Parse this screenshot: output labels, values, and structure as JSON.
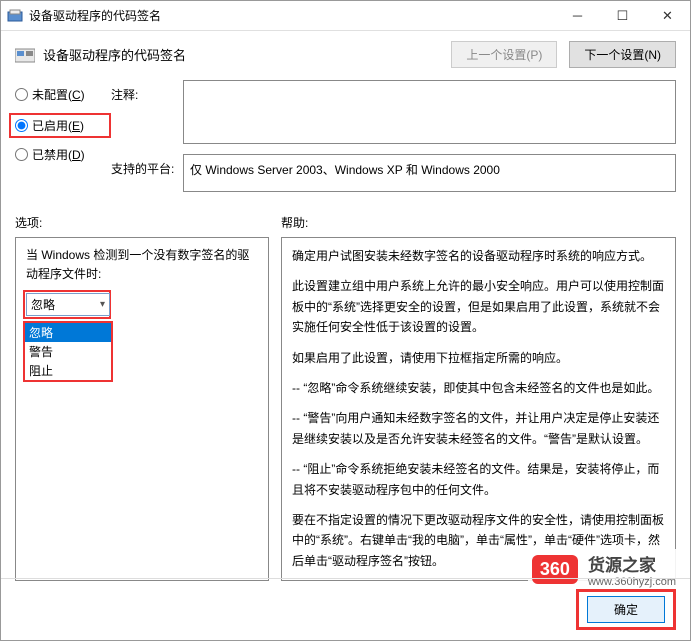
{
  "window": {
    "title": "设备驱动程序的代码签名"
  },
  "header": {
    "title": "设备驱动程序的代码签名",
    "prev_btn": "上一个设置(P)",
    "next_btn": "下一个设置(N)"
  },
  "radios": {
    "not_configured": "未配置(C)",
    "enabled": "已启用(E)",
    "disabled": "已禁用(D)"
  },
  "fields": {
    "comment_label": "注释:",
    "comment_value": "",
    "platform_label": "支持的平台:",
    "platform_value": "仅 Windows Server 2003、Windows XP 和 Windows 2000"
  },
  "sections": {
    "options_label": "选项:",
    "help_label": "帮助:"
  },
  "options": {
    "detect_text": "当 Windows 检测到一个没有数字签名的驱动程序文件时:",
    "selected": "忽略",
    "items": [
      "忽略",
      "警告",
      "阻止"
    ]
  },
  "help": {
    "p1": "确定用户试图安装未经数字签名的设备驱动程序时系统的响应方式。",
    "p2": "此设置建立组中用户系统上允许的最小安全响应。用户可以使用控制面板中的“系统”选择更安全的设置，但是如果启用了此设置，系统就不会实施任何安全性低于该设置的设置。",
    "p3": "如果启用了此设置，请使用下拉框指定所需的响应。",
    "p4": "-- “忽略”命令系统继续安装，即使其中包含未经签名的文件也是如此。",
    "p5": "-- “警告”向用户通知未经数字签名的文件，并让用户决定是停止安装还是继续安装以及是否允许安装未经签名的文件。“警告”是默认设置。",
    "p6": "-- “阻止”命令系统拒绝安装未经签名的文件。结果是，安装将停止，而且将不安装驱动程序包中的任何文件。",
    "p7": "要在不指定设置的情况下更改驱动程序文件的安全性，请使用控制面板中的“系统”。右键单击“我的电脑”，单击“属性”，单击“硬件”选项卡，然后单击“驱动程序签名”按钮。"
  },
  "footer": {
    "ok_label": "确定"
  },
  "watermark": {
    "badge": "360",
    "brand": "货源之家",
    "url": "www.360hyzj.com"
  }
}
